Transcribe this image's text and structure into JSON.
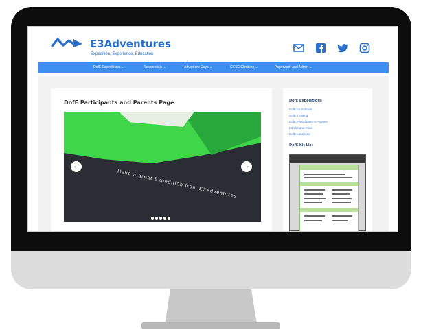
{
  "site": {
    "name": "E3Adventures",
    "tagline": "Expedition, Experience, Education"
  },
  "colors": {
    "brand_blue": "#2a6fc9",
    "nav_blue": "#3d8ef1",
    "slide_green": "#3fd64a"
  },
  "social_icons": [
    "mail-icon",
    "facebook-icon",
    "twitter-icon",
    "instagram-icon"
  ],
  "nav": {
    "items": [
      {
        "label": "DofE Expeditions ⌄"
      },
      {
        "label": "Residentials ⌄"
      },
      {
        "label": "Adventure Days ⌄"
      },
      {
        "label": "GCSE Climbing ⌄"
      },
      {
        "label": "Paperwork and Admin ⌄"
      }
    ]
  },
  "main": {
    "title": "DofE Participants and Parents Page",
    "slider": {
      "caption": "Have a great Expedition from E3Adventures",
      "prev_icon": "chevron-left-icon",
      "next_icon": "chevron-right-icon",
      "slide_count": 5
    }
  },
  "sidebar": {
    "expeditions_title": "DofE Expeditions",
    "links": [
      "DofE for Schools",
      "DofE Training",
      "DofE Participants & Parents",
      "Kit List and Food",
      "DofE Locations"
    ],
    "kit_list_title": "DofE Kit List"
  }
}
